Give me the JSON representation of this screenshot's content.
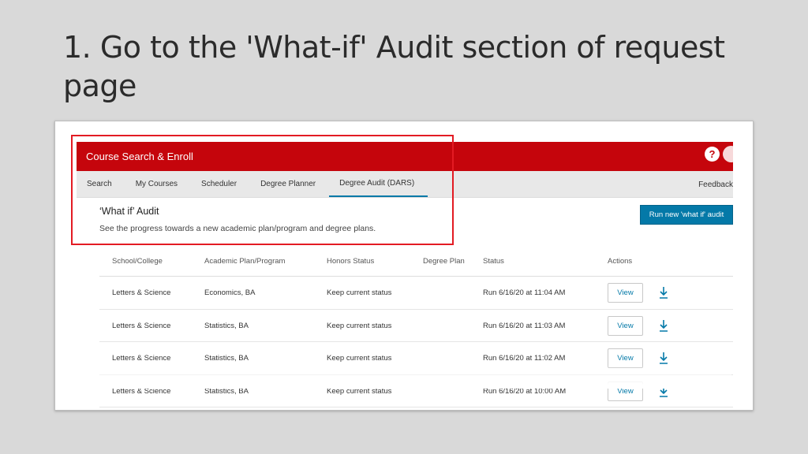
{
  "slide": {
    "title": "1. Go to the 'What-if' Audit section of request page"
  },
  "app": {
    "header_title": "Course Search & Enroll",
    "help_icon": "?",
    "brand_color": "#c5050c",
    "accent_color": "#0479a8"
  },
  "nav": {
    "items": [
      "Search",
      "My Courses",
      "Scheduler",
      "Degree Planner",
      "Degree Audit (DARS)"
    ],
    "active": "Degree Audit (DARS)",
    "feedback": "Feedback"
  },
  "audit": {
    "title": "‘What if’ Audit",
    "subtitle": "See the progress towards a new academic plan/program and degree plans.",
    "run_button": "Run new 'what if' audit"
  },
  "table": {
    "headers": [
      "School/College",
      "Academic Plan/Program",
      "Honors Status",
      "Degree Plan",
      "Status",
      "Actions"
    ],
    "rows": [
      {
        "school": "Letters & Science",
        "plan": "Economics, BA",
        "honors": "Keep current status",
        "degree": "",
        "status": "Run 6/16/20 at 11:04 AM",
        "action": "View"
      },
      {
        "school": "Letters & Science",
        "plan": "Statistics, BA",
        "honors": "Keep current status",
        "degree": "",
        "status": "Run 6/16/20 at 11:03 AM",
        "action": "View"
      },
      {
        "school": "Letters & Science",
        "plan": "Statistics, BA",
        "honors": "Keep current status",
        "degree": "",
        "status": "Run 6/16/20 at 11:02 AM",
        "action": "View"
      },
      {
        "school": "Letters & Science",
        "plan": "Statistics, BA",
        "honors": "Keep current status",
        "degree": "",
        "status": "Run 6/16/20 at 10:00 AM",
        "action": "View"
      }
    ]
  },
  "annotation": {
    "highlight_color": "#e31b23"
  }
}
